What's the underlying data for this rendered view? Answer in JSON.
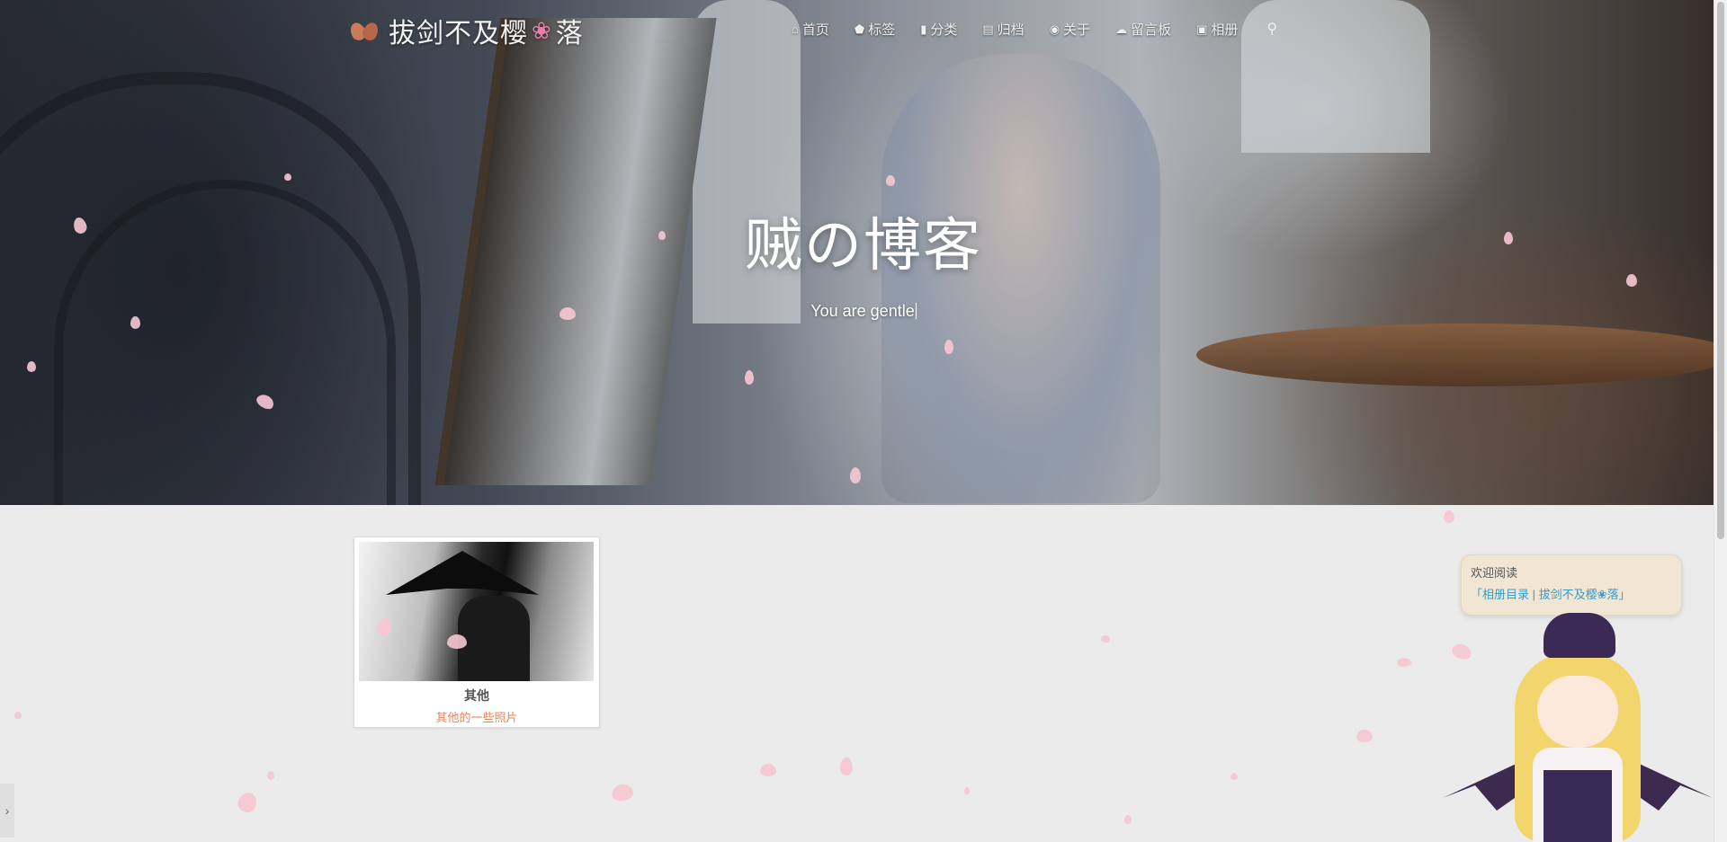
{
  "brand": {
    "name_left": "拔剑不及樱",
    "name_right": "落",
    "flower": "❀"
  },
  "nav": {
    "items": [
      {
        "label": "首页",
        "icon": "⌂"
      },
      {
        "label": "标签",
        "icon": "⬟"
      },
      {
        "label": "分类",
        "icon": "▮"
      },
      {
        "label": "归档",
        "icon": "▤"
      },
      {
        "label": "关于",
        "icon": "◉"
      },
      {
        "label": "留言板",
        "icon": "☁"
      },
      {
        "label": "相册",
        "icon": "▣"
      }
    ],
    "search_icon": "⚲"
  },
  "hero": {
    "title": "贼の博客",
    "subtitle": "You are gentle"
  },
  "album": {
    "name": "其他",
    "description": "其他的一些照片"
  },
  "mascot": {
    "bubble_prefix": "欢迎阅读",
    "bubble_link": "「相册目录 | 拔剑不及樱❀落」"
  },
  "side_toggle": "›"
}
